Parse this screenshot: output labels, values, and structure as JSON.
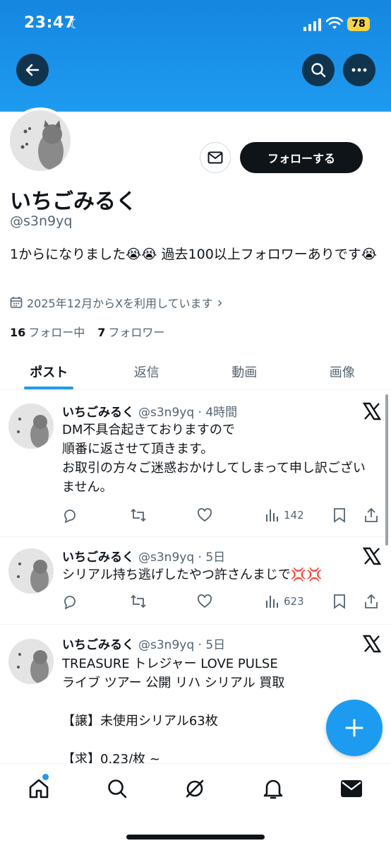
{
  "status_bar": {
    "time": "23:47",
    "battery": "78"
  },
  "profile": {
    "name": "いちごみるく",
    "handle": "@s3n9yq",
    "bio": "1からになりました😭😭 過去100以上フォロワーありです😭",
    "joined": "2025年12月からXを利用しています",
    "following_count": "16",
    "following_label": "フォロー中",
    "followers_count": "7",
    "followers_label": "フォロワー",
    "follow_button": "フォローする"
  },
  "tabs": [
    "ポスト",
    "返信",
    "動画",
    "画像"
  ],
  "posts": [
    {
      "name": "いちごみるく",
      "handle_time": "@s3n9yq · 4時間",
      "text": "DM不具合起きておりますので\n順番に返させて頂きます。\nお取引の方々ご迷惑おかけしてしまって申し訳ございません。",
      "views": "142"
    },
    {
      "name": "いちごみるく",
      "handle_time": "@s3n9yq · 5日",
      "text": "シリアル持ち逃げしたやつ許さんまじで💢💢",
      "views": "623"
    },
    {
      "name": "いちごみるく",
      "handle_time": "@s3n9yq · 5日",
      "text": "TREASURE トレジャー LOVE PULSE\nライブ ツアー 公開 リハ シリアル 買取\n\n【譲】未使用シリアル63枚\n\n【求】0.23/枚 ~",
      "views": ""
    }
  ],
  "colors": {
    "accent": "#1d9bf0",
    "text": "#0f1419",
    "muted": "#536471"
  }
}
